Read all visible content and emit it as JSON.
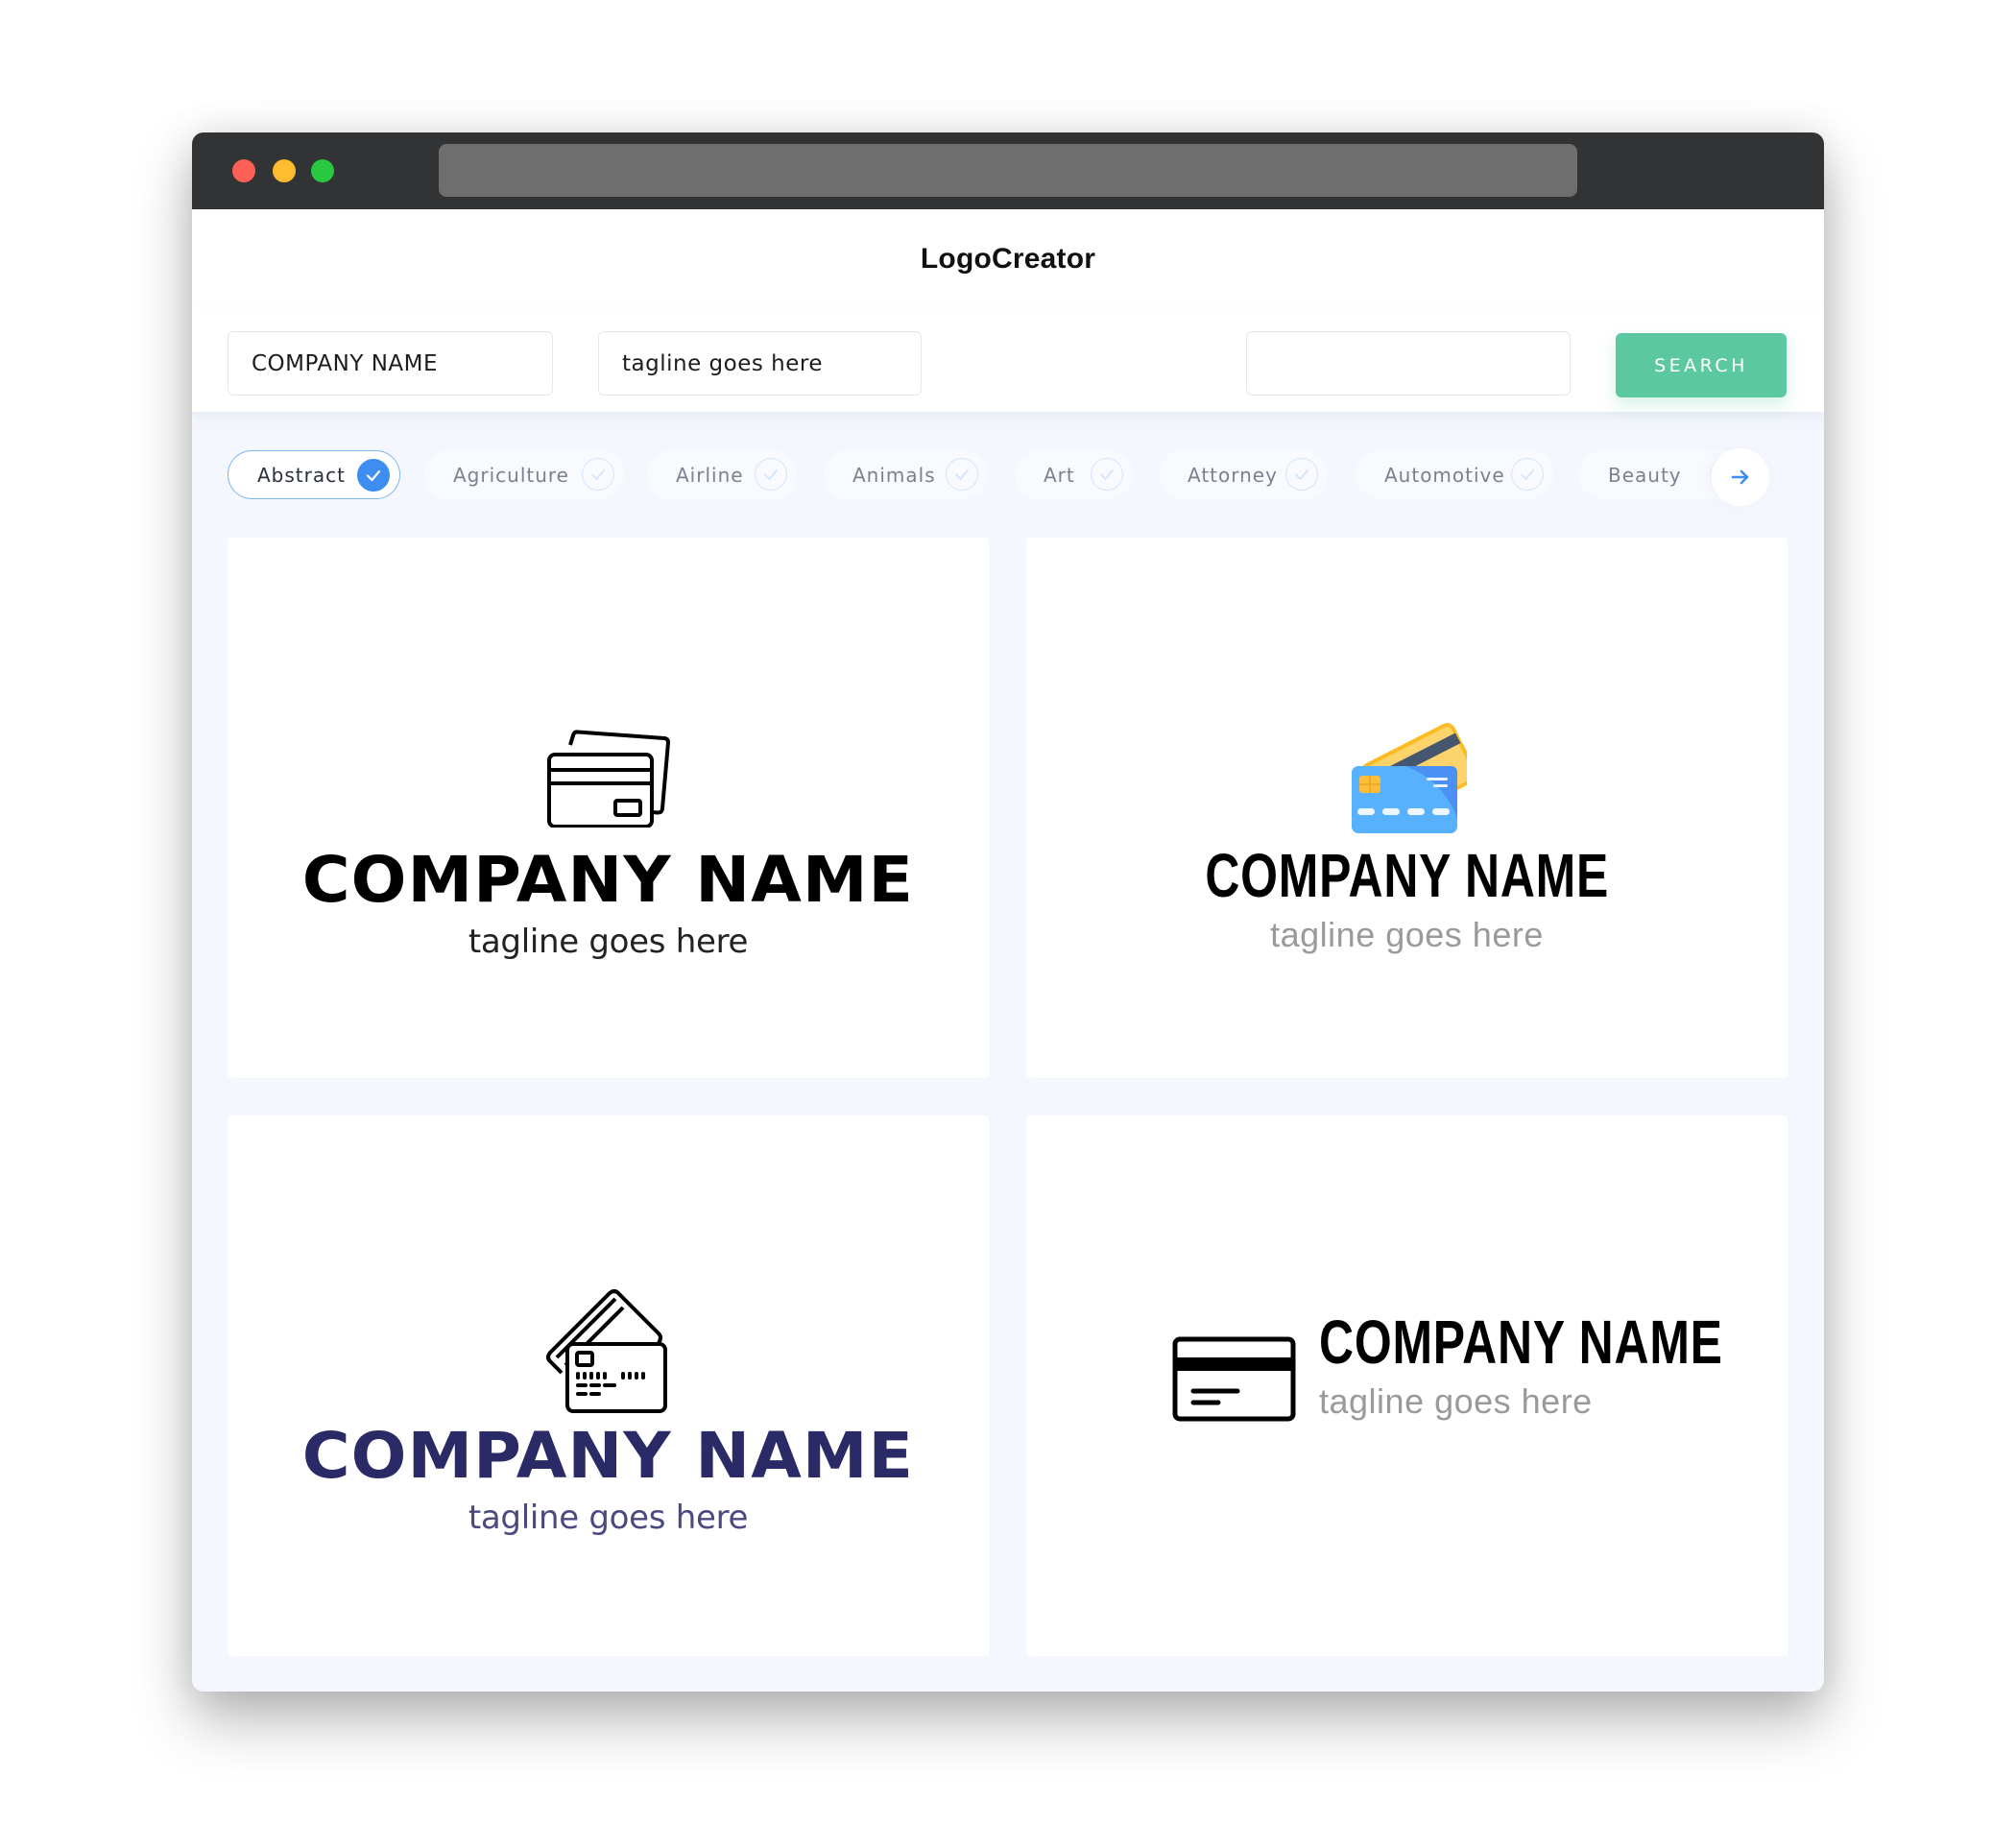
{
  "window": {
    "url": ""
  },
  "header": {
    "brand": "LogoCreator"
  },
  "search": {
    "company_value": "COMPANY NAME",
    "tagline_value": "tagline goes here",
    "keyword_value": "",
    "button_label": "SEARCH"
  },
  "categories": [
    {
      "label": "Abstract",
      "selected": true
    },
    {
      "label": "Agriculture",
      "selected": false
    },
    {
      "label": "Airline",
      "selected": false
    },
    {
      "label": "Animals",
      "selected": false
    },
    {
      "label": "Art",
      "selected": false
    },
    {
      "label": "Attorney",
      "selected": false
    },
    {
      "label": "Automotive",
      "selected": false
    },
    {
      "label": "Beauty",
      "selected": false
    }
  ],
  "logos": [
    {
      "name": "COMPANY NAME",
      "tagline": "tagline goes here",
      "icon": "credit-cards-outline-icon",
      "name_color": "#000000",
      "tagline_color": "#222222"
    },
    {
      "name": "COMPANY NAME",
      "tagline": "tagline goes here",
      "icon": "credit-cards-color-icon",
      "name_color": "#000000",
      "tagline_color": "#9a9a9a"
    },
    {
      "name": "COMPANY NAME",
      "tagline": "tagline goes here",
      "icon": "credit-cards-tilted-outline-icon",
      "name_color": "#2a2a66",
      "tagline_color": "#4a4a80"
    },
    {
      "name": "COMPANY NAME",
      "tagline": "tagline goes here",
      "icon": "credit-card-stripe-icon",
      "name_color": "#000000",
      "tagline_color": "#9a9a9a"
    }
  ],
  "colors": {
    "accent_green": "#5bc8a0",
    "accent_blue": "#3d8ef0",
    "titlebar": "#323334",
    "content_bg": "#f4f7fd"
  }
}
